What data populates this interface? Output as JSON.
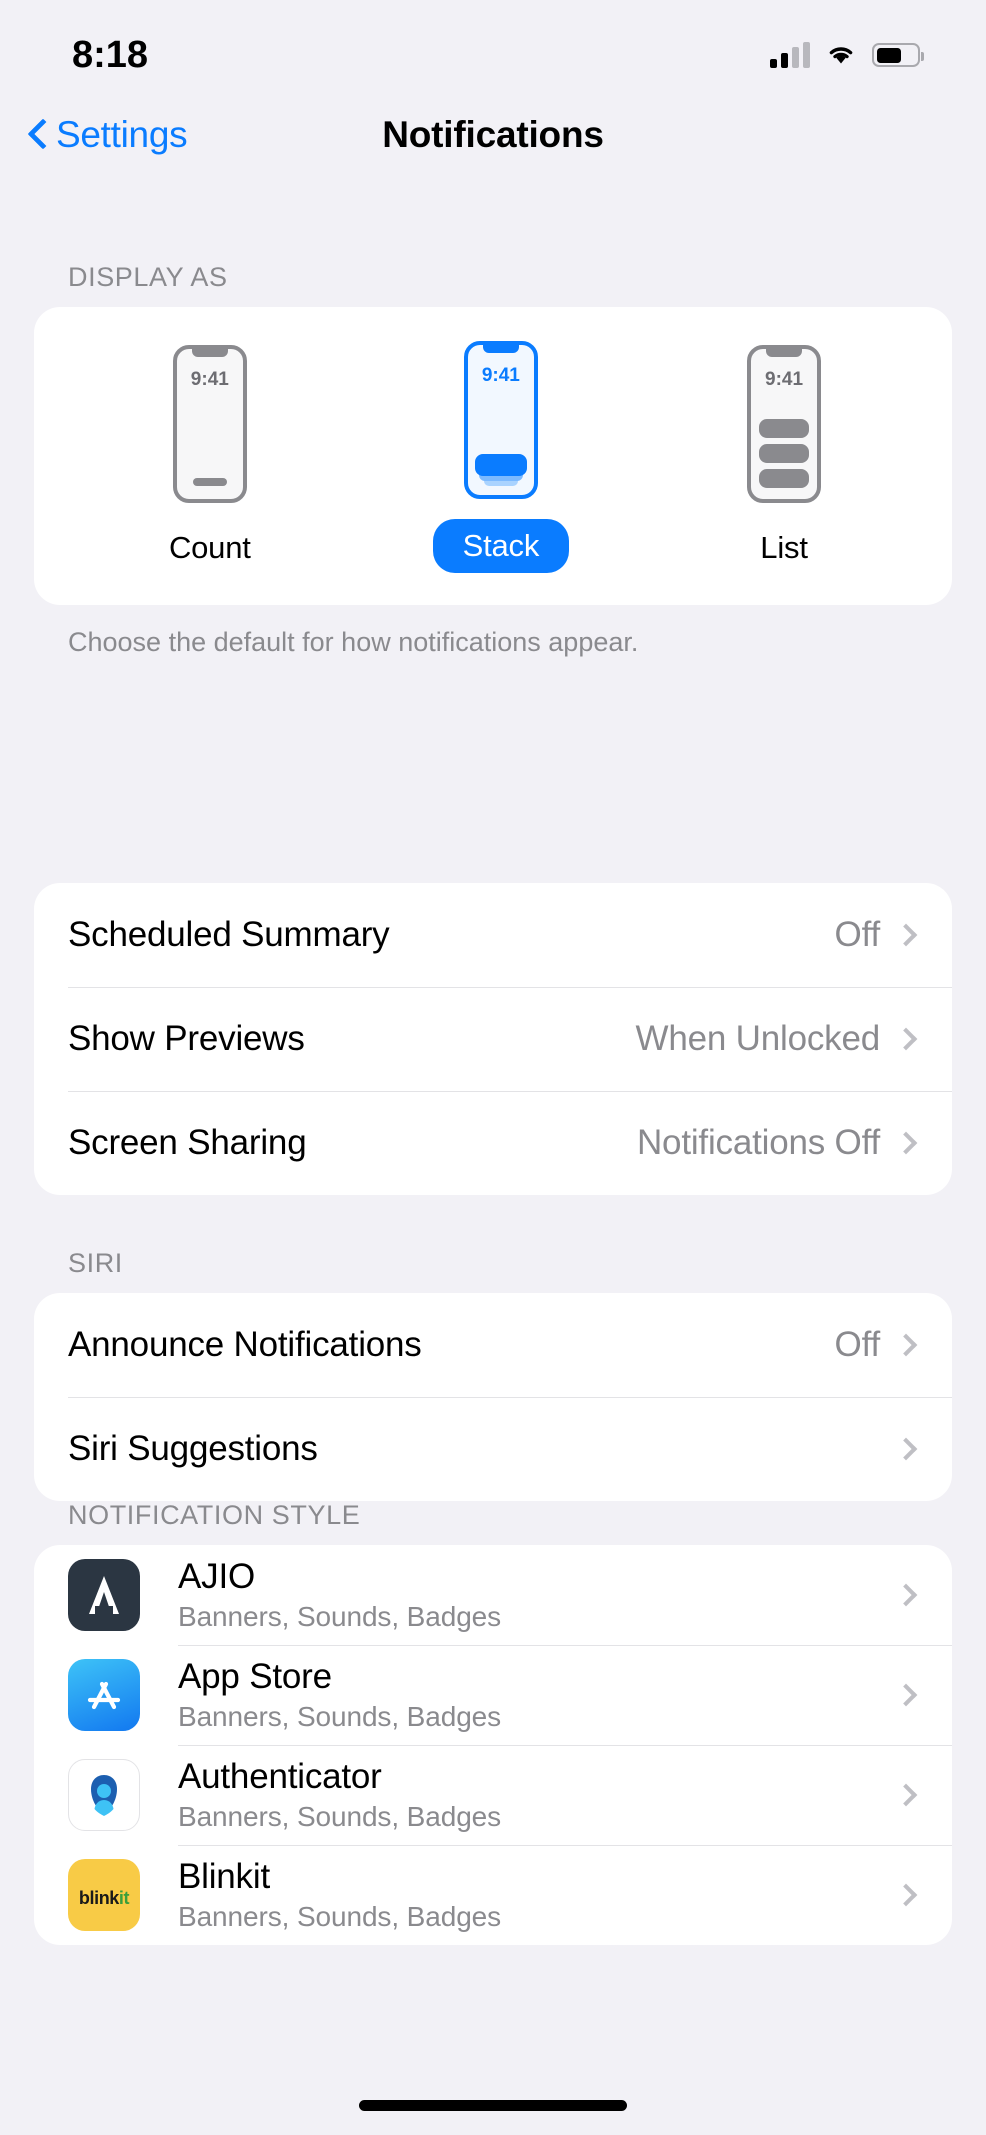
{
  "status_bar": {
    "time": "8:18",
    "cellular_icon": "cellular-signal-icon",
    "wifi_icon": "wifi-icon",
    "battery_icon": "battery-icon"
  },
  "nav": {
    "back_label": "Settings",
    "back_icon": "chevron-left-icon",
    "title": "Notifications"
  },
  "display_as": {
    "header": "DISPLAY AS",
    "footnote": "Choose the default for how notifications appear.",
    "selected": "Stack",
    "options": [
      {
        "label": "Count",
        "preview_time": "9:41",
        "selected": false
      },
      {
        "label": "Stack",
        "preview_time": "9:41",
        "selected": true
      },
      {
        "label": "List",
        "preview_time": "9:41",
        "selected": false
      }
    ]
  },
  "general_group": {
    "rows": [
      {
        "label": "Scheduled Summary",
        "value": "Off"
      },
      {
        "label": "Show Previews",
        "value": "When Unlocked"
      },
      {
        "label": "Screen Sharing",
        "value": "Notifications Off"
      }
    ]
  },
  "siri": {
    "header": "SIRI",
    "rows": [
      {
        "label": "Announce Notifications",
        "value": "Off"
      },
      {
        "label": "Siri Suggestions",
        "value": ""
      }
    ]
  },
  "notification_style": {
    "header": "NOTIFICATION STYLE",
    "apps": [
      {
        "name": "AJIO",
        "subtitle": "Banners, Sounds, Badges",
        "icon": "ajio-app-icon"
      },
      {
        "name": "App Store",
        "subtitle": "Banners, Sounds, Badges",
        "icon": "app-store-app-icon"
      },
      {
        "name": "Authenticator",
        "subtitle": "Banners, Sounds, Badges",
        "icon": "authenticator-app-icon"
      },
      {
        "name": "Blinkit",
        "subtitle": "Banners, Sounds, Badges",
        "icon": "blinkit-app-icon"
      }
    ]
  },
  "colors": {
    "accent": "#0a7cff",
    "background": "#f2f1f6",
    "card": "#ffffff",
    "secondary_text": "#8a8a8e"
  }
}
